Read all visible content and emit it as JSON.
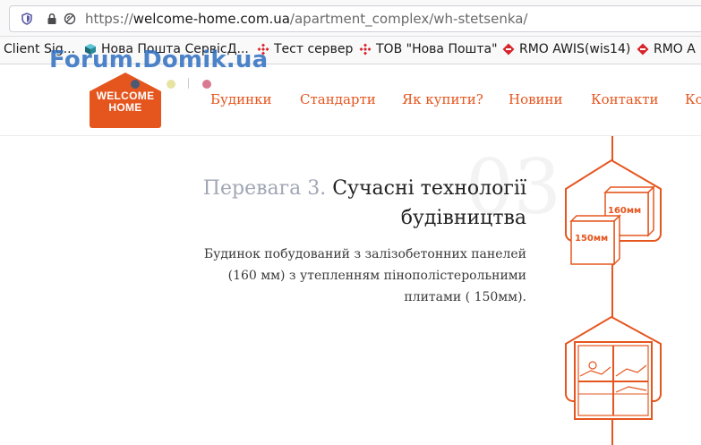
{
  "browser": {
    "url_protocol": "https://",
    "url_host": "welcome-home.com.ua",
    "url_path": "/apartment_complex/wh-stetsenka/"
  },
  "bookmarks": [
    {
      "label": "Client Sig...",
      "icon": "none"
    },
    {
      "label": "Нова Пошта СервісД...",
      "icon": "cube-icon"
    },
    {
      "label": "Тест сервер",
      "icon": "nova-poshta-icon"
    },
    {
      "label": "ТОВ \"Нова Пошта\"",
      "icon": "nova-poshta-icon"
    },
    {
      "label": "RMO AWIS(wis14)",
      "icon": "awis-icon"
    },
    {
      "label": "RMO A",
      "icon": "awis-icon"
    }
  ],
  "watermark": "Forum.Domik.ua",
  "site": {
    "logo_line1": "WELCOME",
    "logo_line2": "HOME",
    "brand_color": "#e5561f",
    "nav": [
      "Будинки",
      "Стандарти",
      "Як купити?",
      "Новини",
      "Контакти",
      "Ко"
    ]
  },
  "feature": {
    "number": "03",
    "prefix": "Перевага 3.",
    "title_line1": "Сучасні технології",
    "title_line2": "будівництва",
    "desc_line1": "Будинок побудований з залізобетонних панелей",
    "desc_line2": "(160 мм) з утепленням пінополістерольними",
    "desc_line3": "плитами ( 150мм).",
    "icon_label_1": "160мм",
    "icon_label_2": "150мм"
  }
}
